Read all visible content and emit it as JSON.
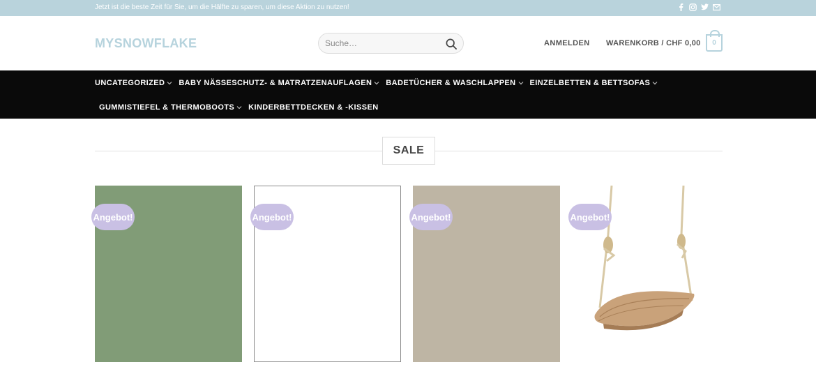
{
  "topbar": {
    "message": "Jetzt ist die beste Zeit für Sie, um die Hälfte zu sparen, um diese Aktion zu nutzen!",
    "social_icons": [
      "facebook-icon",
      "instagram-icon",
      "twitter-icon",
      "mail-icon"
    ]
  },
  "header": {
    "logo": "MYSNOWFLAKE",
    "search_placeholder": "Suche…",
    "login_label": "ANMELDEN",
    "cart_label": "WARENKORB / CHF 0,00",
    "cart_count": "0"
  },
  "nav": {
    "row1": [
      {
        "label": "UNCATEGORIZED"
      },
      {
        "label": "BABY NÄSSESCHUTZ- & MATRATZENAUFLAGEN"
      },
      {
        "label": "BADETÜCHER & WASCHLAPPEN"
      },
      {
        "label": "EINZELBETTEN & BETTSOFAS"
      }
    ],
    "row2": [
      {
        "label": "GUMMISTIEFEL & THERMOBOOTS"
      },
      {
        "label": "KINDERBETTDECKEN & -KISSEN"
      }
    ]
  },
  "section": {
    "title": "SALE"
  },
  "products": [
    {
      "badge": "Angebot!",
      "color": "#819c77"
    },
    {
      "badge": "Angebot!",
      "color": "#ffffff"
    },
    {
      "badge": "Angebot!",
      "color": "#beb5a4"
    },
    {
      "badge": "Angebot!",
      "color": "#ffffff"
    }
  ],
  "colors": {
    "accent": "#b6d3dd",
    "topbar": "#b9d3dc",
    "nav": "#0a0a0a",
    "badge": "#c9c0e4"
  }
}
